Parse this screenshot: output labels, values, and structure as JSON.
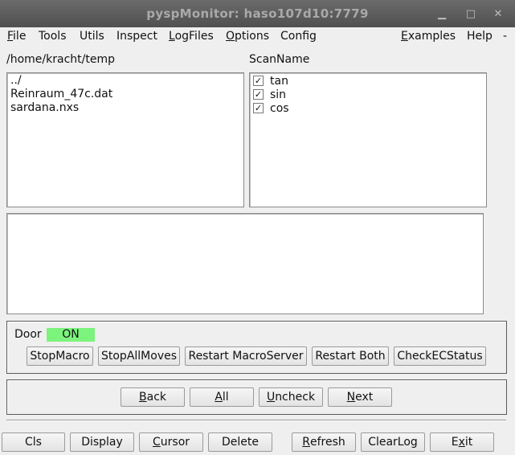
{
  "window": {
    "title": "pyspMonitor: haso107d10:7779"
  },
  "menu": {
    "file": "File",
    "tools": "Tools",
    "utils": "Utils",
    "inspect": "Inspect",
    "logfiles": "LogFiles",
    "options": "Options",
    "config": "Config",
    "examples": "Examples",
    "help": "Help",
    "tearoff": "-"
  },
  "files": {
    "path": "/home/kracht/temp",
    "items": [
      "../",
      "Reinraum_47c.dat",
      "sardana.nxs"
    ]
  },
  "scans": {
    "header": "ScanName",
    "items": [
      {
        "name": "tan",
        "checked": "✓"
      },
      {
        "name": "sin",
        "checked": "✓"
      },
      {
        "name": "cos",
        "checked": "✓"
      }
    ]
  },
  "door": {
    "label": "Door",
    "status": "ON",
    "status_color": "#7cf37c",
    "buttons": [
      "StopMacro",
      "StopAllMoves",
      "Restart MacroServer",
      "Restart Both",
      "CheckECStatus"
    ]
  },
  "nav": {
    "back": "Back",
    "all": "All",
    "uncheck": "Uncheck",
    "next": "Next"
  },
  "bottom": {
    "cls": "Cls",
    "display": "Display",
    "cursor": "Cursor",
    "delete": "Delete",
    "refresh": "Refresh",
    "clearlog": "ClearLog",
    "exit": "Exit"
  }
}
